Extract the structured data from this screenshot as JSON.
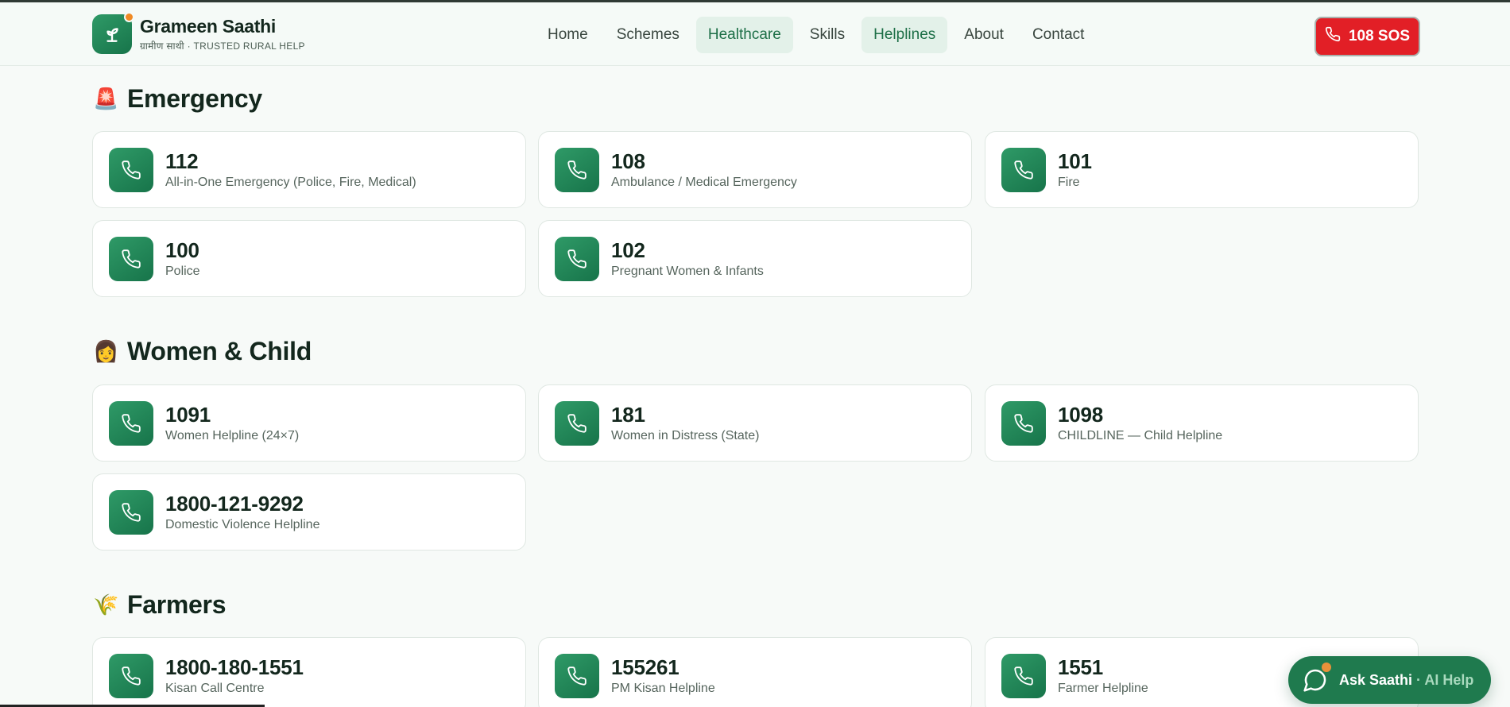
{
  "brand": {
    "name": "Grameen Saathi",
    "subtitle": "ग्रामीण साथी · TRUSTED RURAL HELP"
  },
  "nav": [
    {
      "label": "Home",
      "active": false
    },
    {
      "label": "Schemes",
      "active": false
    },
    {
      "label": "Healthcare",
      "active": true
    },
    {
      "label": "Skills",
      "active": false
    },
    {
      "label": "Helplines",
      "active": true
    },
    {
      "label": "About",
      "active": false
    },
    {
      "label": "Contact",
      "active": false
    }
  ],
  "sos": {
    "label": "108 SOS",
    "color": "#e21f26"
  },
  "sections": [
    {
      "emoji": "🚨",
      "title": "Emergency",
      "cards": [
        {
          "number": "112",
          "desc": "All-in-One Emergency (Police, Fire, Medical)"
        },
        {
          "number": "108",
          "desc": "Ambulance / Medical Emergency"
        },
        {
          "number": "101",
          "desc": "Fire"
        },
        {
          "number": "100",
          "desc": "Police"
        },
        {
          "number": "102",
          "desc": "Pregnant Women & Infants"
        }
      ]
    },
    {
      "emoji": "👩",
      "title": "Women & Child",
      "cards": [
        {
          "number": "1091",
          "desc": "Women Helpline (24×7)"
        },
        {
          "number": "181",
          "desc": "Women in Distress (State)"
        },
        {
          "number": "1098",
          "desc": "CHILDLINE — Child Helpline"
        },
        {
          "number": "1800-121-9292",
          "desc": "Domestic Violence Helpline"
        }
      ]
    },
    {
      "emoji": "🌾",
      "title": "Farmers",
      "cards": [
        {
          "number": "1800-180-1551",
          "desc": "Kisan Call Centre"
        },
        {
          "number": "155261",
          "desc": "PM Kisan Helpline"
        },
        {
          "number": "1551",
          "desc": "Farmer Helpline"
        }
      ]
    }
  ],
  "ask": {
    "label": "Ask Saathi",
    "sub": "· AI Help"
  },
  "colors": {
    "accent": "#1f7a4e",
    "sos": "#e21f26"
  }
}
